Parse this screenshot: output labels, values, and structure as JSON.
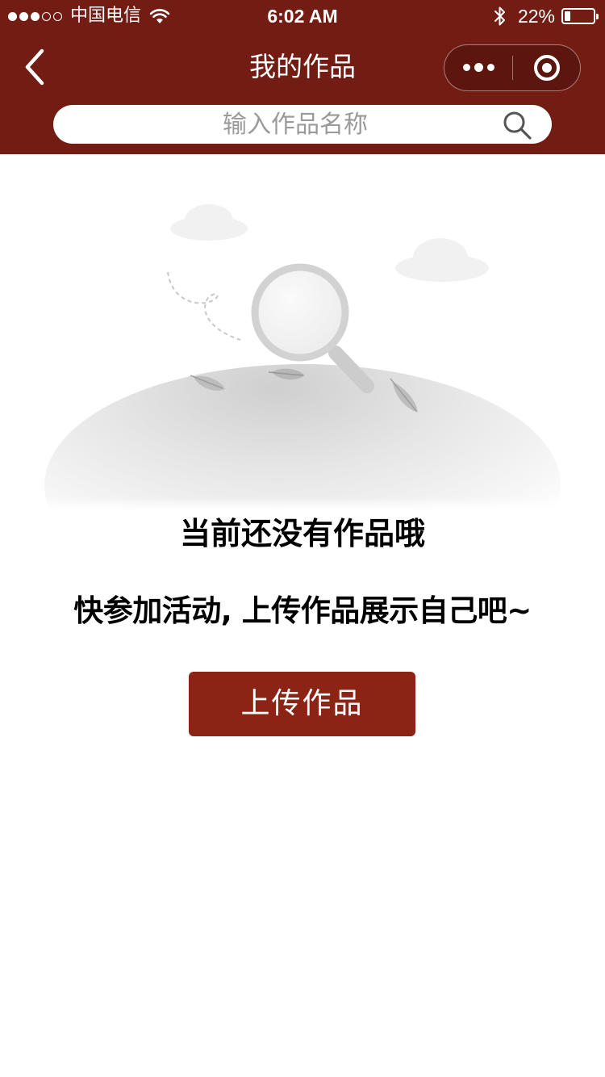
{
  "status_bar": {
    "carrier": "中国电信",
    "signal_strength": 3,
    "signal_max": 5,
    "time": "6:02 AM",
    "battery_percent": "22%",
    "battery_level": 0.22
  },
  "nav": {
    "title": "我的作品",
    "background_color": "#721c13",
    "icons": [
      "chevron-left-icon",
      "more-dots-icon",
      "target-close-icon"
    ]
  },
  "search": {
    "placeholder": "输入作品名称",
    "value": "",
    "icon": "search-icon"
  },
  "empty_state": {
    "title": "当前还没有作品哦",
    "subtitle": "快参加活动, 上传作品展示自己吧~",
    "illustration": "magnifier-on-hill"
  },
  "actions": {
    "upload_label": "上传作品",
    "button_color": "#8b2415"
  }
}
